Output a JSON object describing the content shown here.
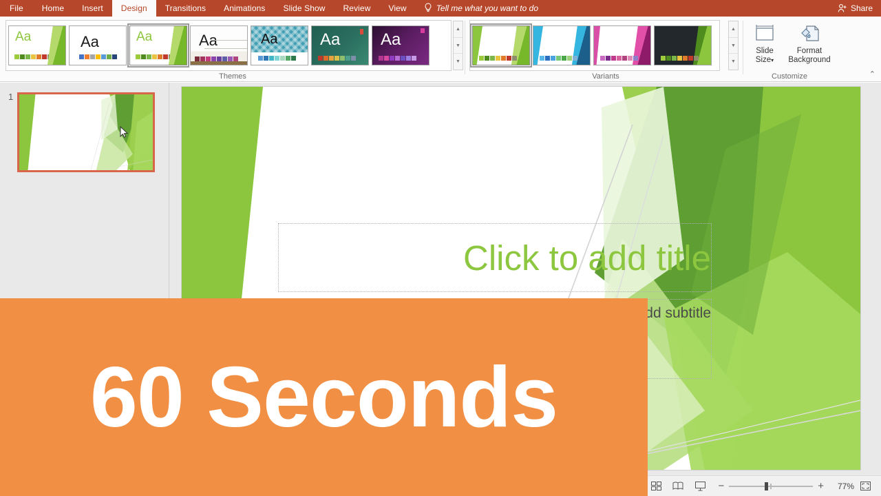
{
  "app": {
    "accent_red": "#b7472a",
    "theme_green": "#8dc63f",
    "overlay_orange": "#f18f45"
  },
  "ribbon": {
    "tabs": [
      {
        "label": "File",
        "active": false
      },
      {
        "label": "Home",
        "active": false
      },
      {
        "label": "Insert",
        "active": false
      },
      {
        "label": "Design",
        "active": true
      },
      {
        "label": "Transitions",
        "active": false
      },
      {
        "label": "Animations",
        "active": false
      },
      {
        "label": "Slide Show",
        "active": false
      },
      {
        "label": "Review",
        "active": false
      },
      {
        "label": "View",
        "active": false
      }
    ],
    "tell_me": "Tell me what you want to do",
    "share": "Share",
    "collapse_chevron": "⌃"
  },
  "themes": {
    "group_label": "Themes",
    "scroll_up": "▲",
    "scroll_down": "▼",
    "scroll_more": "▼",
    "items": [
      {
        "name": "office-theme",
        "aa": "Aa",
        "selected": false
      },
      {
        "name": "blank-theme",
        "aa": "Aa",
        "selected": false
      },
      {
        "name": "facet-theme",
        "aa": "Aa",
        "selected": true
      },
      {
        "name": "berlin-theme",
        "aa": "Aa",
        "selected": false
      },
      {
        "name": "dividend-theme",
        "aa": "Aa",
        "selected": false
      },
      {
        "name": "frame-theme",
        "aa": "Aa",
        "selected": false
      },
      {
        "name": "quotable-theme",
        "aa": "Aa",
        "selected": false
      }
    ]
  },
  "variants": {
    "group_label": "Variants",
    "scroll_up": "▲",
    "scroll_down": "▼",
    "scroll_more": "▼",
    "items": [
      {
        "name": "variant-green",
        "selected": true
      },
      {
        "name": "variant-blue",
        "selected": false
      },
      {
        "name": "variant-magenta",
        "selected": false
      },
      {
        "name": "variant-dark",
        "selected": false
      }
    ]
  },
  "customize": {
    "group_label": "Customize",
    "slide_size": "Slide\nSize",
    "slide_size_line1": "Slide",
    "slide_size_line2": "Size",
    "slide_size_caret": "▾",
    "format_background_line1": "Format",
    "format_background_line2": "Background"
  },
  "slide_panel": {
    "slide_number": "1"
  },
  "slide": {
    "title_placeholder": "Click to add title",
    "subtitle_placeholder": "Click to add subtitle"
  },
  "status_bar": {
    "view_normal": "normal-view",
    "view_sorter": "slide-sorter-view",
    "view_reading": "reading-view",
    "view_show": "slide-show-view",
    "zoom_out": "−",
    "zoom_in": "+",
    "zoom_level": "77%",
    "fit_to_window": "fit-slide-to-window"
  },
  "overlay": {
    "text": "60 Seconds"
  }
}
